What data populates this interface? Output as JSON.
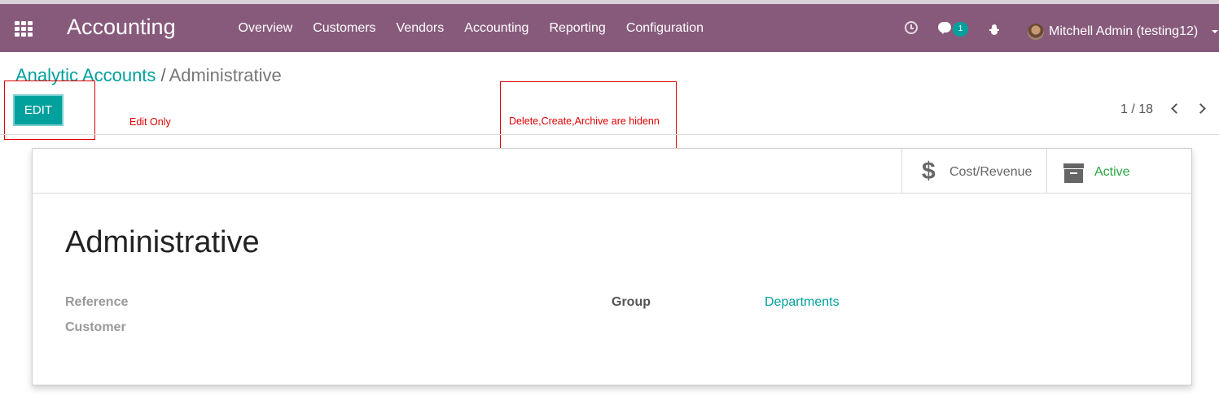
{
  "navbar": {
    "app_title": "Accounting",
    "menu": [
      "Overview",
      "Customers",
      "Vendors",
      "Accounting",
      "Reporting",
      "Configuration"
    ],
    "chat_count": "1",
    "user": "Mitchell Admin (testing12)"
  },
  "breadcrumb": {
    "parent": "Analytic Accounts",
    "separator": "/",
    "current": "Administrative"
  },
  "control_panel": {
    "edit_label": "EDIT",
    "pager": "1 / 18"
  },
  "annotations": {
    "edit_note": "Edit Only",
    "hidden_note": "Delete,Create,Archive are hidenn",
    "color": "#e00000"
  },
  "sheet": {
    "buttons": {
      "cost_revenue": "Cost/Revenue",
      "active": "Active"
    },
    "title": "Administrative",
    "fields": {
      "reference_label": "Reference",
      "customer_label": "Customer",
      "group_label": "Group",
      "group_value": "Departments"
    }
  },
  "colors": {
    "navbar": "#875a7b",
    "primary": "#00a09d",
    "active": "#28a745"
  }
}
